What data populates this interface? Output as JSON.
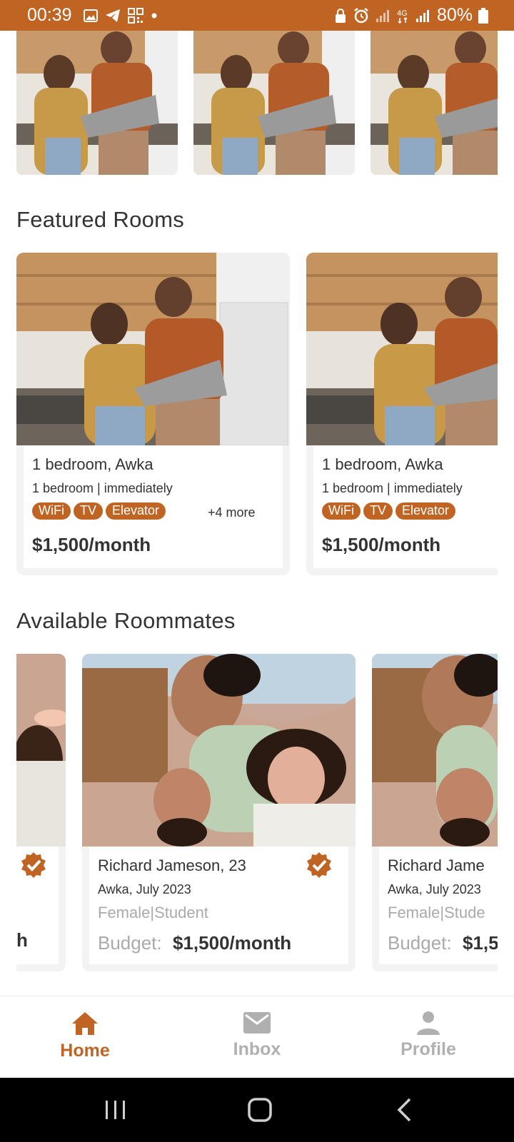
{
  "status_bar": {
    "time": "00:39",
    "battery": "80%",
    "network": "4G"
  },
  "sections": {
    "featured_title": "Featured Rooms",
    "roommates_title": "Available Roommates"
  },
  "featured_rooms": [
    {
      "title": "1 bedroom, Awka",
      "subtitle": "1 bedroom | immediately",
      "tags": [
        "WiFi",
        "TV",
        "Elevator"
      ],
      "more": "+4 more",
      "price": "$1,500/month"
    },
    {
      "title": "1 bedroom, Awka",
      "subtitle": "1 bedroom | immediately",
      "tags": [
        "WiFi",
        "TV",
        "Elevator"
      ],
      "price": "$1,500/month"
    }
  ],
  "roommates": [
    {
      "partial_text": "h"
    },
    {
      "name": "Richard Jameson, 23",
      "location": "Awka, July 2023",
      "details": "Female|Student",
      "budget_label": "Budget:",
      "budget_value": "$1,500/month"
    },
    {
      "name": "Richard Jame",
      "location": "Awka, July 2023",
      "details": "Female|Stude",
      "budget_label": "Budget:",
      "budget_value": "$1,5"
    }
  ],
  "nav": {
    "home": "Home",
    "inbox": "Inbox",
    "profile": "Profile"
  },
  "colors": {
    "accent": "#bf6423",
    "inactive": "#b0b0b0"
  }
}
